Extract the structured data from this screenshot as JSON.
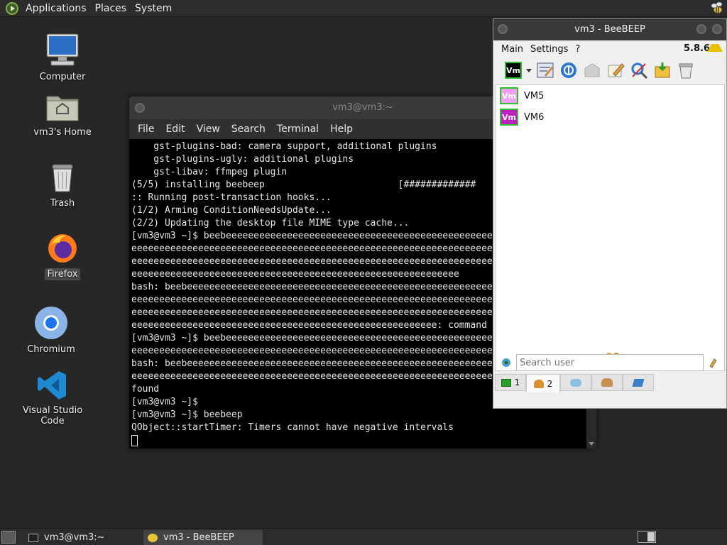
{
  "top_panel": {
    "menus": [
      "Applications",
      "Places",
      "System"
    ]
  },
  "desktop_icons": {
    "computer": "Computer",
    "home": "vm3's Home",
    "trash": "Trash",
    "firefox": "Firefox",
    "chromium": "Chromium",
    "vscode": "Visual Studio Code"
  },
  "terminal": {
    "title": "vm3@vm3:~",
    "menu": [
      "File",
      "Edit",
      "View",
      "Search",
      "Terminal",
      "Help"
    ],
    "lines": [
      "    gst-plugins-bad: camera support, additional plugins",
      "    gst-plugins-ugly: additional plugins",
      "    gst-libav: ffmpeg plugin",
      "(5/5) installing beebeep                        [#############",
      ":: Running post-transaction hooks...",
      "(1/2) Arming ConditionNeedsUpdate...",
      "(2/2) Updating the desktop file MIME type cache...",
      "[vm3@vm3 ~]$ beebeeeeeeeeeeeeeeeeeeeeeeeeeeeeeeeeeeeeeeeeeeeeeeeeeee",
      "eeeeeeeeeeeeeeeeeeeeeeeeeeeeeeeeeeeeeeeeeeeeeeeeeeeeeeeeeeeeeeeeeeee",
      "eeeeeeeeeeeeeeeeeeeeeeeeeeeeeeeeeeeeeeeeeeeeeeeeeeeeeeeeeeeeeeeeeeee",
      "eeeeeeeeeeeeeeeeeeeeeeeeeeeeeeeeeeeeeeeeeeeeeeeeeeeeeeeeeee",
      "bash: beebeeeeeeeeeeeeeeeeeeeeeeeeeeeeeeeeeeeeeeeeeeeeeeeeeeeeeeeeeee",
      "eeeeeeeeeeeeeeeeeeeeeeeeeeeeeeeeeeeeeeeeeeeeeeeeeeeeeeeeeeeeeeeeeeee",
      "eeeeeeeeeeeeeeeeeeeeeeeeeeeeeeeeeeeeeeeeeeeeeeeeeeeeeeeeeeeeeeeeeeee",
      "eeeeeeeeeeeeeeeeeeeeeeeeeeeeeeeeeeeeeeeeeeeeeeeeeeeeeee: command n",
      "[vm3@vm3 ~]$ beebeeeeeeeeeeeeeeeeeeeeeeeeeeeeeeeeeeeeeeeeeeeeeeeeeee",
      "eeeeeeeeeeeeeeeeeeeeeeeeeeeeeeeeeeeeeeeeeeeeeeeeeeeeeeeeeeeeeeeeeeee",
      "bash: beebeeeeeeeeeeeeeeeeeeeeeeeeeeeeeeeeeeeeeeeeeeeeeeeeeeeeeeeeeee",
      "eeeeeeeeeeeeeeeeeeeeeeeeeeeeeeeeeeeeeeeeeeeeeeeeeeeeeeeeeeeeeeeeeeee",
      "found",
      "[vm3@vm3 ~]$",
      "[vm3@vm3 ~]$ beebeep",
      "QObject::startTimer: Timers cannot have negative intervals"
    ]
  },
  "beebeep": {
    "title": "vm3 - BeeBEEP",
    "menu": [
      "Main",
      "Settings",
      "?"
    ],
    "version": "5.8.6",
    "my_avatar": "Vm",
    "users": [
      {
        "avatar": "Vm",
        "name": "VM5",
        "color": "#2ec02e"
      },
      {
        "avatar": "Vm",
        "name": "VM6",
        "color": "#c020c0"
      }
    ],
    "search_placeholder": "Search user",
    "tabs": [
      {
        "icon": "chat-icon",
        "count": "1"
      },
      {
        "icon": "users-icon",
        "count": "2"
      },
      {
        "icon": "messages-icon",
        "count": ""
      },
      {
        "icon": "groups-icon",
        "count": ""
      },
      {
        "icon": "file-transfer-icon",
        "count": ""
      }
    ]
  },
  "taskbar": {
    "items": [
      "vm3@vm3:~",
      "vm3 - BeeBEEP"
    ]
  },
  "colors": {
    "desktop": "#272727",
    "panel": "#2c2c2c",
    "vm5": "#2ec02e",
    "vm6": "#c020c0"
  }
}
